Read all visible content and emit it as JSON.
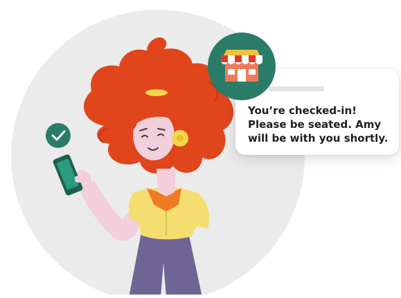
{
  "notification": {
    "message": "You’re checked-in! Please be seated. Amy will be with you shortly."
  },
  "icons": {
    "check": "check-icon",
    "store": "store-icon",
    "phone": "phone-icon"
  },
  "colors": {
    "accent_green": "#2a7c68",
    "hair_red": "#e0451c",
    "shirt_yellow": "#f4de6f",
    "collar_orange": "#ee7b22",
    "pants_purple": "#6f6595",
    "skin_pink": "#f2cfdb",
    "background_circle": "#ebebeb"
  }
}
